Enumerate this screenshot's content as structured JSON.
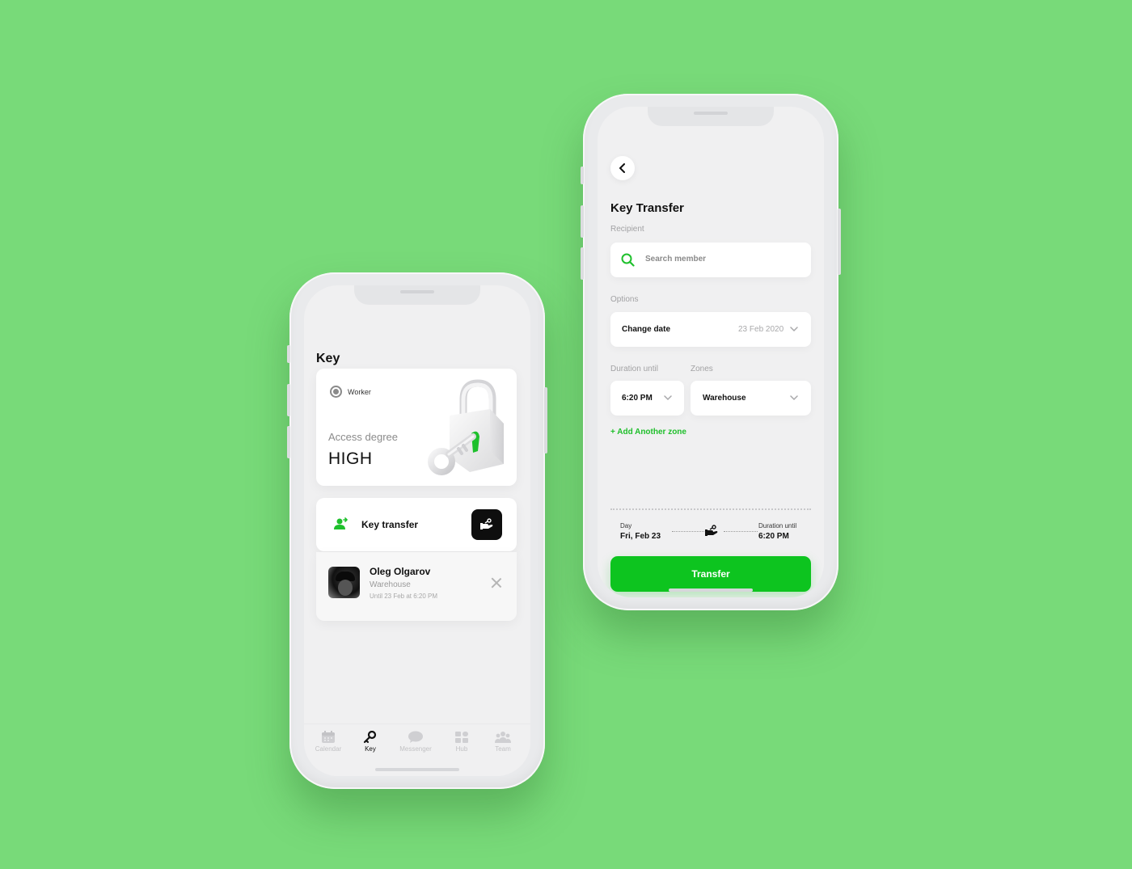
{
  "colors": {
    "background": "#78da79",
    "accent": "#0dc41f",
    "accent_text": "#1fbf2b",
    "dark_button": "#0e0e0e"
  },
  "key_screen": {
    "title": "Key",
    "access_card": {
      "role": "Worker",
      "access_label": "Access degree",
      "access_value": "HIGH",
      "illustration": "padlock-with-key-illustration"
    },
    "transfer_card": {
      "label": "Key transfer",
      "icon": "person-transfer-icon",
      "button_icon": "hand-key-icon"
    },
    "member": {
      "name": "Oleg Olgarov",
      "zone": "Warehouse",
      "until": "Until 23 Feb at 6:20 PM"
    },
    "tabs": [
      {
        "label": "Calendar",
        "icon": "calendar-icon",
        "active": false
      },
      {
        "label": "Key",
        "icon": "key-icon",
        "active": true
      },
      {
        "label": "Messenger",
        "icon": "chat-icon",
        "active": false
      },
      {
        "label": "Hub",
        "icon": "hub-icon",
        "active": false
      },
      {
        "label": "Team",
        "icon": "team-icon",
        "active": false
      }
    ]
  },
  "transfer_screen": {
    "title": "Key Transfer",
    "recipient_label": "Recipient",
    "search_placeholder": "Search member",
    "options_label": "Options",
    "change_date_label": "Change date",
    "change_date_value": "23 Feb 2020",
    "duration_label": "Duration until",
    "duration_value": "6:20 PM",
    "zones_label": "Zones",
    "zones_value": "Warehouse",
    "add_zone": "+ Add Another zone",
    "summary": {
      "day_label": "Day",
      "day_value": "Fri, Feb 23",
      "duration_label": "Duration until",
      "duration_value": "6:20 PM"
    },
    "button_label": "Transfer"
  }
}
